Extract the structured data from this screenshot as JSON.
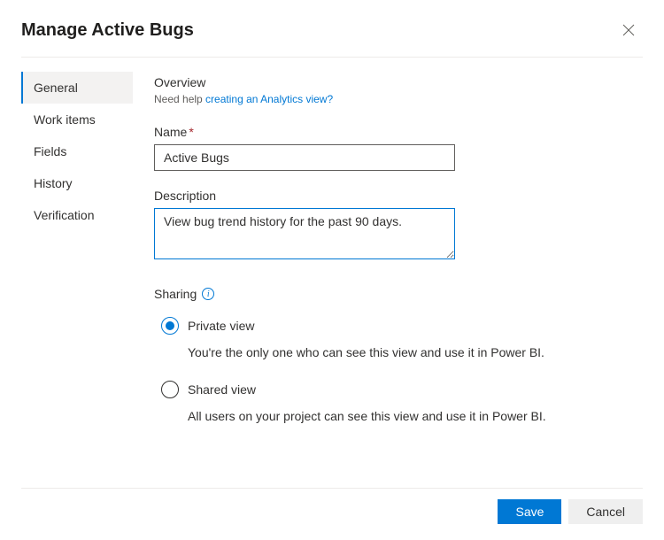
{
  "header": {
    "title": "Manage Active Bugs"
  },
  "sidebar": {
    "items": [
      {
        "label": "General",
        "active": true
      },
      {
        "label": "Work items",
        "active": false
      },
      {
        "label": "Fields",
        "active": false
      },
      {
        "label": "History",
        "active": false
      },
      {
        "label": "Verification",
        "active": false
      }
    ]
  },
  "main": {
    "overview_title": "Overview",
    "help_prefix": "Need help ",
    "help_link": "creating an Analytics view?",
    "name_label": "Name",
    "name_value": "Active Bugs",
    "description_label": "Description",
    "description_value": "View bug trend history for the past 90 days.",
    "sharing_label": "Sharing",
    "radios": [
      {
        "label": "Private view",
        "desc": "You're the only one who can see this view and use it in Power BI.",
        "checked": true
      },
      {
        "label": "Shared view",
        "desc": "All users on your project can see this view and use it in Power BI.",
        "checked": false
      }
    ]
  },
  "footer": {
    "save": "Save",
    "cancel": "Cancel"
  }
}
